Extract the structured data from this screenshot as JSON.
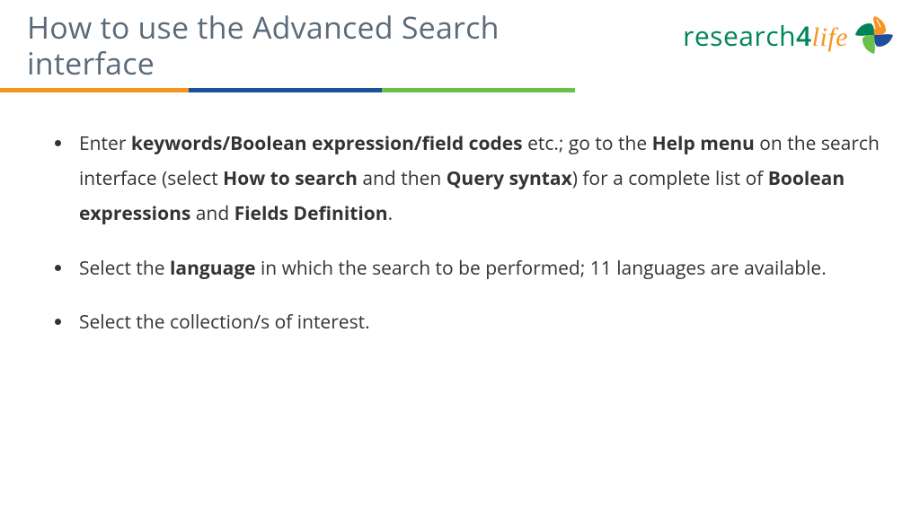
{
  "header": {
    "title": "How to use the Advanced Search interface",
    "logo": {
      "text_research": "research",
      "text_4": "4",
      "text_life": "life"
    }
  },
  "rule_colors": [
    "#f7941d",
    "#1f4e9b",
    "#6cbf4b"
  ],
  "bullets": [
    {
      "runs": [
        {
          "t": "Enter ",
          "b": false
        },
        {
          "t": "keywords/Boolean expression/field codes",
          "b": true
        },
        {
          "t": " etc.; go to the ",
          "b": false
        },
        {
          "t": "Help menu",
          "b": true
        },
        {
          "t": " on the search interface (select ",
          "b": false
        },
        {
          "t": "How to search",
          "b": true
        },
        {
          "t": " and then ",
          "b": false
        },
        {
          "t": "Query syntax",
          "b": true
        },
        {
          "t": ") for a complete list of ",
          "b": false
        },
        {
          "t": "Boolean expressions",
          "b": true
        },
        {
          "t": " and ",
          "b": false
        },
        {
          "t": "Fields Definition",
          "b": true
        },
        {
          "t": ".",
          "b": false
        }
      ]
    },
    {
      "runs": [
        {
          "t": "Select the ",
          "b": false
        },
        {
          "t": "language",
          "b": true
        },
        {
          "t": " in which the search to be performed; 11 languages are available.",
          "b": false
        }
      ]
    },
    {
      "runs": [
        {
          "t": "Select the collection/s of interest.",
          "b": false
        }
      ]
    }
  ]
}
